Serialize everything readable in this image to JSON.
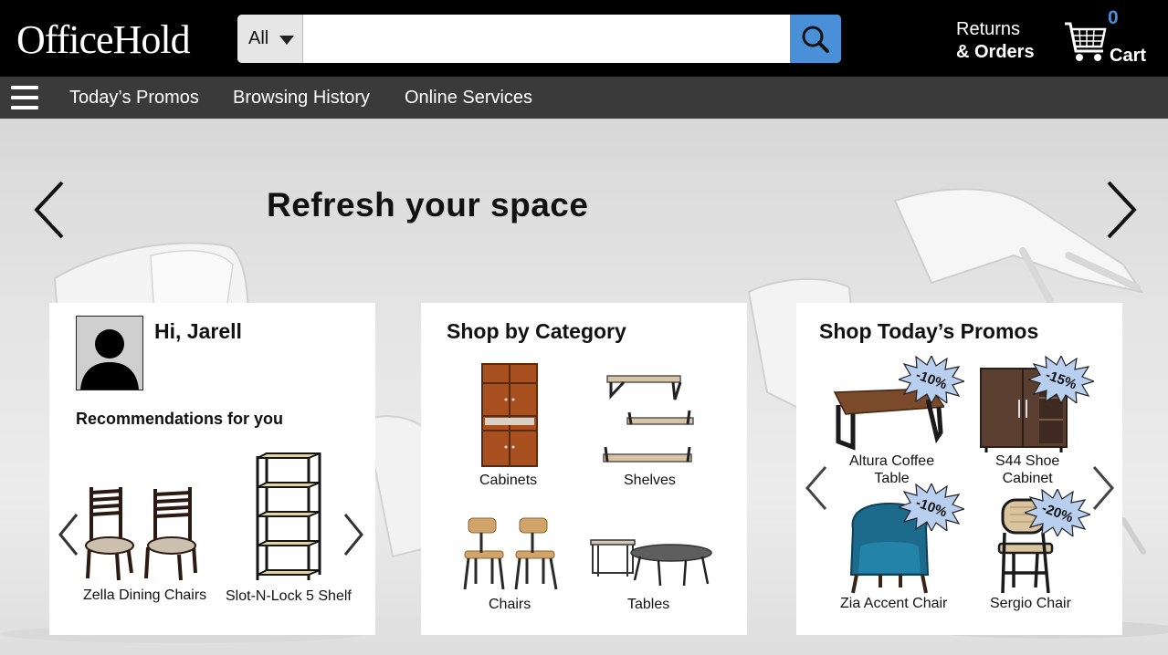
{
  "header": {
    "logo": "OfficeHold",
    "search": {
      "category": "All",
      "placeholder": "",
      "value": ""
    },
    "returns_line1": "Returns",
    "returns_line2": "& Orders",
    "cart_count": "0",
    "cart_label": "Cart"
  },
  "nav": {
    "links": [
      "Today’s Promos",
      "Browsing History",
      "Online Services"
    ]
  },
  "hero": {
    "title": "Refresh your space"
  },
  "greeting_card": {
    "greeting": "Hi, Jarell",
    "recommendations_title": "Recommendations for you",
    "items": [
      "Zella Dining Chairs",
      "Slot-N-Lock 5 Shelf"
    ]
  },
  "category_card": {
    "title": "Shop by Category",
    "items": [
      "Cabinets",
      "Shelves",
      "Chairs",
      "Tables"
    ]
  },
  "promo_card": {
    "title": "Shop Today’s Promos",
    "items": [
      {
        "name": "Altura Coffee Table",
        "name_line1": "Altura Coffee",
        "name_line2": "Table",
        "discount": "-10%"
      },
      {
        "name": "S44 Shoe Cabinet",
        "name_line1": "S44 Shoe",
        "name_line2": "Cabinet",
        "discount": "-15%"
      },
      {
        "name": "Zia Accent Chair",
        "discount": "-10%"
      },
      {
        "name": "Sergio Chair",
        "discount": "-20%"
      }
    ]
  },
  "colors": {
    "header_bg": "#000000",
    "nav_bg": "#3a3a3a",
    "accent_blue": "#4a90d9",
    "badge_fill": "#b9cff0"
  },
  "icons": [
    "search-icon",
    "cart-icon",
    "hamburger-menu-icon",
    "chevron-left-icon",
    "chevron-right-icon",
    "user-avatar-icon"
  ]
}
